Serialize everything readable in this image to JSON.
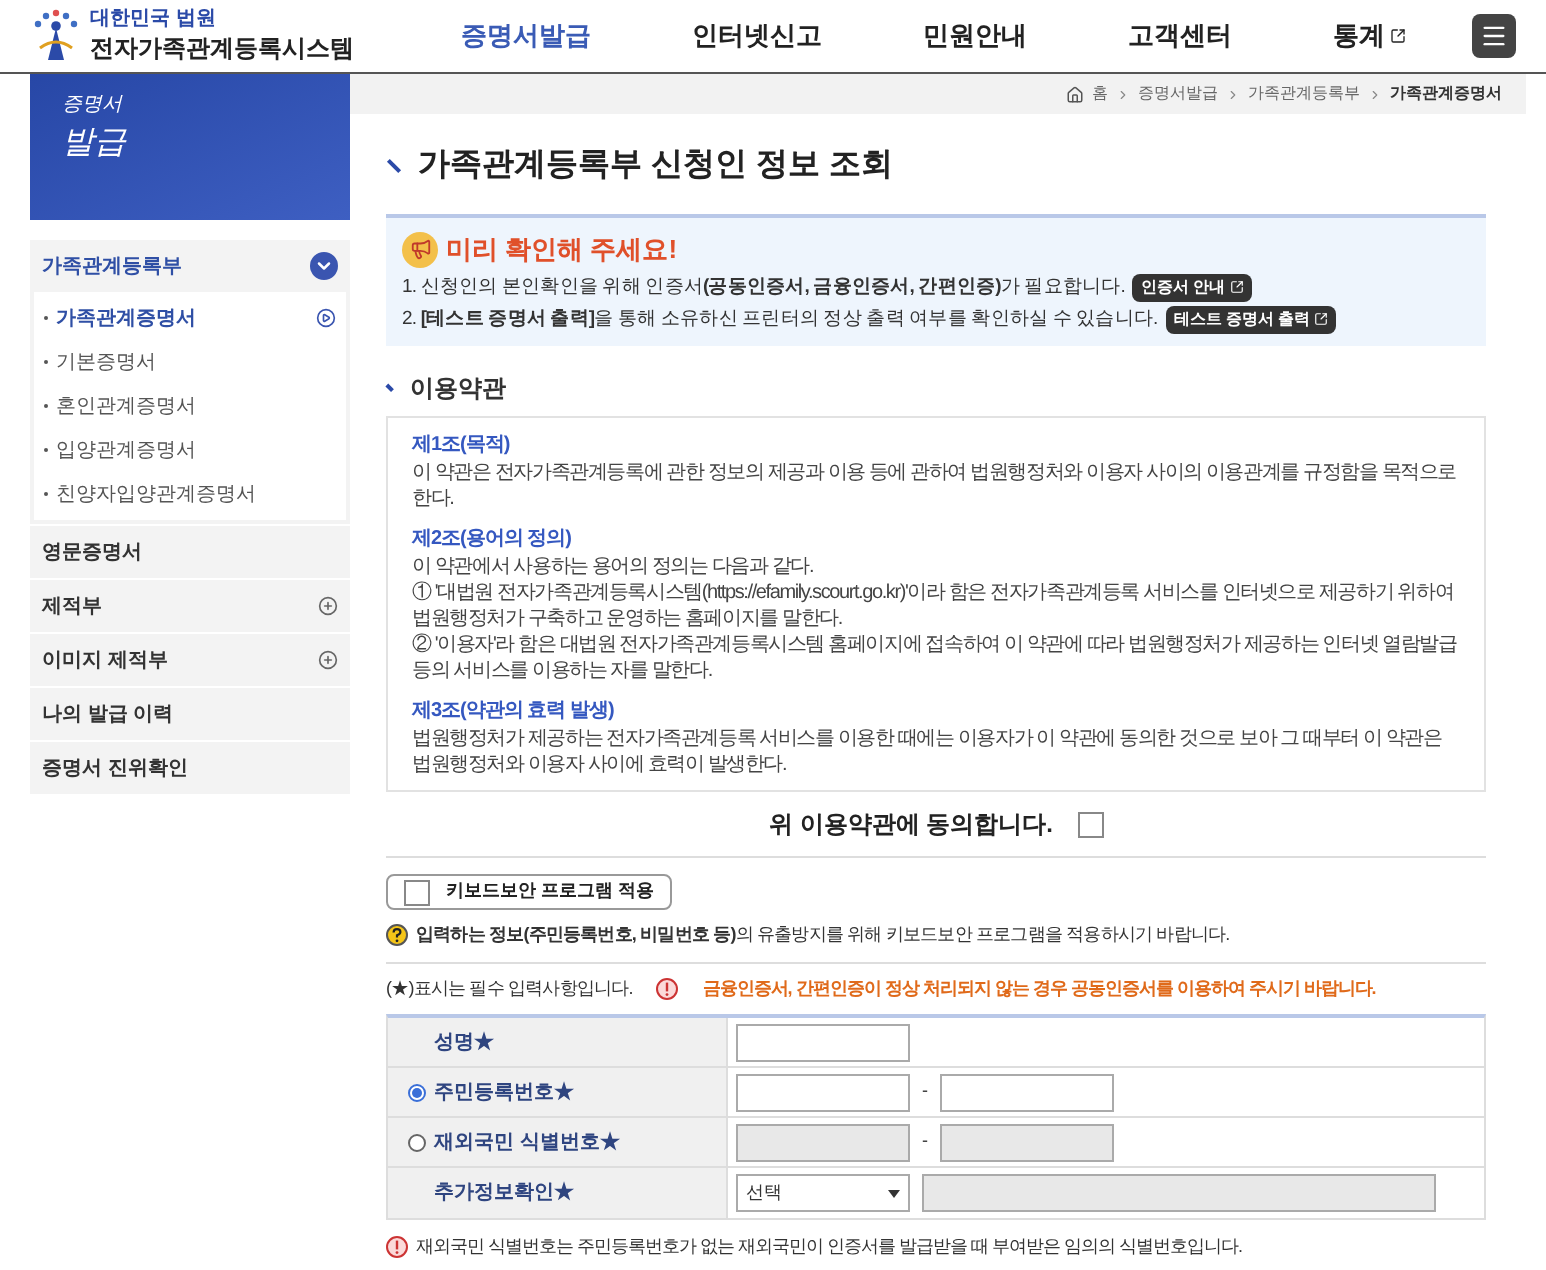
{
  "header": {
    "logo_caption": "대한민국 법원",
    "logo_title": "전자가족관계등록시스템",
    "nav": [
      {
        "label": "증명서발급",
        "selected": true,
        "external": false
      },
      {
        "label": "인터넷신고",
        "selected": false,
        "external": false
      },
      {
        "label": "민원안내",
        "selected": false,
        "external": false
      },
      {
        "label": "고객센터",
        "selected": false,
        "external": false
      },
      {
        "label": "통계",
        "selected": false,
        "external": true
      }
    ]
  },
  "sidebar": {
    "banner": [
      "증명서",
      "발급"
    ],
    "items": [
      {
        "label": "가족관계등록부",
        "kind": "group",
        "expanded": true,
        "children": [
          {
            "label": "가족관계증명서",
            "selected": true
          },
          {
            "label": "기본증명서",
            "selected": false
          },
          {
            "label": "혼인관계증명서",
            "selected": false
          },
          {
            "label": "입양관계증명서",
            "selected": false
          },
          {
            "label": "친양자입양관계증명서",
            "selected": false
          }
        ]
      },
      {
        "label": "영문증명서",
        "kind": "link"
      },
      {
        "label": "제적부",
        "kind": "group",
        "expanded": false
      },
      {
        "label": "이미지 제적부",
        "kind": "group",
        "expanded": false
      },
      {
        "label": "나의 발급 이력",
        "kind": "link"
      },
      {
        "label": "증명서 진위확인",
        "kind": "link"
      }
    ]
  },
  "breadcrumb": [
    "홈",
    "증명서발급",
    "가족관계등록부",
    "가족관계증명서"
  ],
  "page_title": "가족관계등록부 신청인 정보 조회",
  "notice": {
    "title": "미리 확인해 주세요!",
    "lines": [
      {
        "text": "1. 신청인의 본인확인을 위해 인증서**(공동인증서, 금융인증서, 간편인증)**가 필요합니다.",
        "button": "인증서 안내"
      },
      {
        "text": "2. **[테스트 증명서 출력]**을 통해 소유하신 프린터의 정상 출력 여부를 확인하실 수 있습니다.",
        "button": "테스트 증명서 출력"
      }
    ]
  },
  "terms": {
    "heading": "이용약관",
    "articles": [
      {
        "title": "제1조(목적)",
        "paragraphs": [
          "이 약관은 전자가족관계등록에 관한 정보의 제공과 이용 등에 관하여 법원행정처와 이용자 사이의 이용관계를 규정함을 목적으로 한다."
        ]
      },
      {
        "title": "제2조(용어의 정의)",
        "paragraphs": [
          "이 약관에서 사용하는 용어의 정의는 다음과 같다.",
          "① '대법원 전자가족관계등록시스템(https://efamily.scourt.go.kr)'이라 함은 전자가족관계등록 서비스를 인터넷으로 제공하기 위하여 법원행정처가 구축하고 운영하는 홈페이지를 말한다.",
          "② '이용자'라 함은 대법원 전자가족관계등록시스템 홈페이지에 접속하여 이 약관에 따라 법원행정처가 제공하는 인터넷 열람발급 등의 서비스를 이용하는 자를 말한다."
        ]
      },
      {
        "title": "제3조(약관의 효력 발생)",
        "paragraphs": [
          "법원행정처가 제공하는 전자가족관계등록 서비스를 이용한 때에는 이용자가 이 약관에 동의한 것으로 보아 그 때부터 이 약관은 법원행정처와 이용자 사이에 효력이 발생한다."
        ]
      }
    ]
  },
  "agree": {
    "label": "위 이용약관에 동의합니다.",
    "checked": false
  },
  "keyboard_security": {
    "label": "키보드보안 프로그램 적용",
    "checked": false
  },
  "keyboard_help": "**입력하는 정보(주민등록번호, 비밀번호 등)**의 유출방지를 위해 키보드보안 프로그램을 적용하시기 바랍니다.",
  "required_note": "(★)표시는 필수 입력사항입니다.",
  "warning": "금융인증서, 간편인증이 정상 처리되지 않는 경우 공동인증서를 이용하여 주시기 바랍니다.",
  "form": [
    {
      "label": "성명★",
      "kind": "text"
    },
    {
      "label": "주민등록번호★",
      "kind": "radio_split",
      "selected": true,
      "separator": "-"
    },
    {
      "label": "재외국민 식별번호★",
      "kind": "radio_split",
      "selected": false,
      "separator": "-"
    },
    {
      "label": "추가정보확인★",
      "kind": "select",
      "value": "선택"
    }
  ],
  "footnote": "재외국민 식별번호는 주민등록번호가 없는 재외국민이 인증서를 발급받을 때 부여받은 임의의 식별번호입니다."
}
